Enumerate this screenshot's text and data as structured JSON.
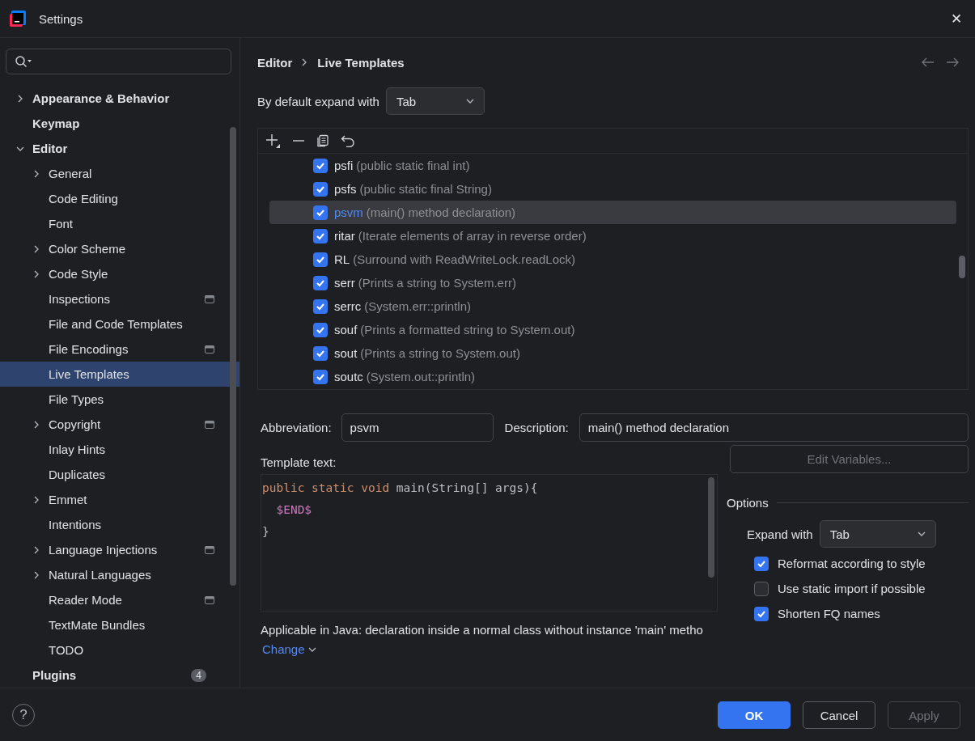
{
  "window": {
    "title": "Settings",
    "close": "✕"
  },
  "sidebar": {
    "items": [
      {
        "label": "Appearance & Behavior",
        "selected": false,
        "expanded": false,
        "bold": true
      },
      {
        "label": "Keymap",
        "selected": false,
        "bold": true
      },
      {
        "label": "Editor",
        "selected": false,
        "expanded": true,
        "bold": true,
        "children": [
          {
            "label": "General",
            "selected": false,
            "expanded": false
          },
          {
            "label": "Code Editing",
            "selected": false
          },
          {
            "label": "Font",
            "selected": false
          },
          {
            "label": "Color Scheme",
            "selected": false,
            "expanded": false
          },
          {
            "label": "Code Style",
            "selected": false,
            "expanded": false
          },
          {
            "label": "Inspections",
            "selected": false,
            "project": true
          },
          {
            "label": "File and Code Templates",
            "selected": false
          },
          {
            "label": "File Encodings",
            "selected": false,
            "project": true
          },
          {
            "label": "Live Templates",
            "selected": true
          },
          {
            "label": "File Types",
            "selected": false
          },
          {
            "label": "Copyright",
            "selected": false,
            "expanded": false,
            "project": true
          },
          {
            "label": "Inlay Hints",
            "selected": false
          },
          {
            "label": "Duplicates",
            "selected": false
          },
          {
            "label": "Emmet",
            "selected": false,
            "expanded": false
          },
          {
            "label": "Intentions",
            "selected": false
          },
          {
            "label": "Language Injections",
            "selected": false,
            "expanded": false,
            "project": true
          },
          {
            "label": "Natural Languages",
            "selected": false,
            "expanded": false
          },
          {
            "label": "Reader Mode",
            "selected": false,
            "project": true
          },
          {
            "label": "TextMate Bundles",
            "selected": false
          },
          {
            "label": "TODO",
            "selected": false
          }
        ]
      },
      {
        "label": "Plugins",
        "selected": false,
        "bold": true,
        "badge": "4"
      }
    ]
  },
  "breadcrumb": [
    "Editor",
    "Live Templates"
  ],
  "expand_default": {
    "label": "By default expand with",
    "value": "Tab"
  },
  "templates": [
    {
      "abbreviation": "psfi",
      "description": "(public static final int)",
      "checked": true,
      "selected": false
    },
    {
      "abbreviation": "psfs",
      "description": "(public static final String)",
      "checked": true,
      "selected": false
    },
    {
      "abbreviation": "psvm",
      "description": "(main() method declaration)",
      "checked": true,
      "selected": true
    },
    {
      "abbreviation": "ritar",
      "description": "(Iterate elements of array in reverse order)",
      "checked": true,
      "selected": false
    },
    {
      "abbreviation": "RL",
      "description": "(Surround with ReadWriteLock.readLock)",
      "checked": true,
      "selected": false
    },
    {
      "abbreviation": "serr",
      "description": "(Prints a string to System.err)",
      "checked": true,
      "selected": false
    },
    {
      "abbreviation": "serrc",
      "description": "(System.err::println)",
      "checked": true,
      "selected": false
    },
    {
      "abbreviation": "souf",
      "description": "(Prints a formatted string to System.out)",
      "checked": true,
      "selected": false
    },
    {
      "abbreviation": "sout",
      "description": "(Prints a string to System.out)",
      "checked": true,
      "selected": false
    },
    {
      "abbreviation": "soutc",
      "description": "(System.out::println)",
      "checked": true,
      "selected": false
    }
  ],
  "form": {
    "abbreviation_label": "Abbreviation:",
    "abbreviation": "psvm",
    "description_label": "Description:",
    "description": "main() method declaration",
    "template_label": "Template text:",
    "code": [
      {
        "indent": false,
        "tokens": [
          {
            "kind": "keyword",
            "text": "public static void"
          },
          {
            "kind": "plain",
            "text": " main(String[] args){"
          }
        ]
      },
      {
        "indent": true,
        "tokens": [
          {
            "kind": "variable",
            "text": "$END$"
          }
        ]
      },
      {
        "indent": false,
        "tokens": [
          {
            "kind": "plain",
            "text": "}"
          }
        ]
      }
    ],
    "applicable": "Applicable in Java: declaration inside a normal class without instance 'main' metho",
    "change": "Change"
  },
  "edit_variables": {
    "label": "Edit Variables...",
    "disabled": true
  },
  "options": {
    "title": "Options",
    "expand_label": "Expand with",
    "expand_value": "Tab",
    "checks": [
      {
        "label": "Reformat according to style",
        "checked": true
      },
      {
        "label": "Use static import if possible",
        "checked": false
      },
      {
        "label": "Shorten FQ names",
        "checked": true
      }
    ]
  },
  "footer": {
    "help": "?",
    "buttons": [
      {
        "label": "OK",
        "kind": "primary",
        "disabled": false
      },
      {
        "label": "Cancel",
        "kind": "normal",
        "disabled": false
      },
      {
        "label": "Apply",
        "kind": "normal",
        "disabled": true
      }
    ]
  }
}
